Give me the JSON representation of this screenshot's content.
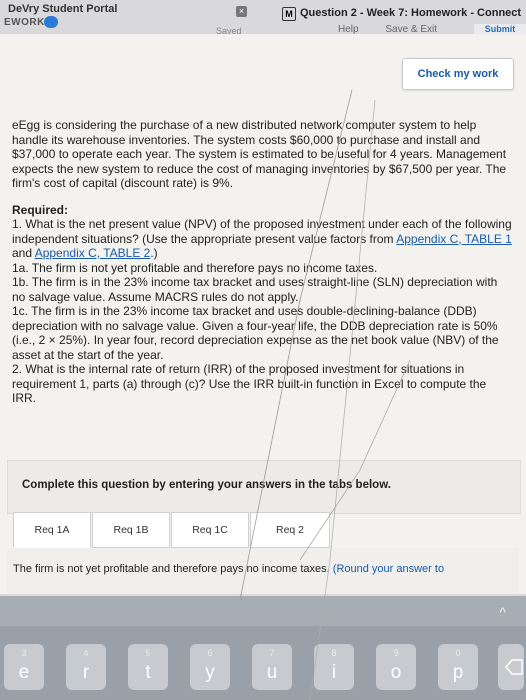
{
  "tabs": {
    "left_title": "DeVry Student Portal",
    "left_sub": "EWORK",
    "right_title": "Question 2 - Week 7: Homework - Connect",
    "toolbar": [
      "Help",
      "Save & Exit"
    ],
    "submit": "Submit",
    "saved": "Saved"
  },
  "check_label": "Check my work",
  "question": {
    "intro": "eEgg is considering the purchase of a new distributed network computer system to help handle its warehouse inventories. The system costs $60,000 to purchase and install and $37,000 to operate each year. The system is estimated to be useful for 4 years. Management expects the new system to reduce the cost of managing inventories by $67,500 per year. The firm's cost of capital (discount rate) is 9%.",
    "required_heading": "Required:",
    "q1_pre": "1. What is the net present value (NPV) of the proposed investment under each of the following independent situations? (Use the appropriate present value factors from ",
    "link1": "Appendix C, TABLE 1",
    "q1_mid": " and ",
    "link2": "Appendix C, TABLE 2",
    "q1_post": ".)",
    "q1a": "1a. The firm is not yet profitable and therefore pays no income taxes.",
    "q1b": "1b. The firm is in the 23% income tax bracket and uses straight-line (SLN) depreciation with no salvage value. Assume MACRS rules do not apply.",
    "q1c": "1c. The firm is in the 23%  income tax bracket and uses double-declining-balance (DDB) depreciation with no salvage value. Given a four-year life, the DDB depreciation rate is 50% (i.e., 2 × 25%). In year four, record depreciation expense as the net book value (NBV) of the asset at the start of the year.",
    "q2": "2. What is the internal rate of return (IRR) of the proposed investment for situations in requirement 1, parts (a) through (c)? Use the IRR built-in function in Excel to compute the IRR."
  },
  "complete_text": "Complete this question by entering your answers in the tabs below.",
  "req_tabs": [
    "Req 1A",
    "Req 1B",
    "Req 1C",
    "Req 2"
  ],
  "answer_text": "The firm is not yet profitable and therefore pays no income taxes.",
  "answer_note": "(Round your answer to",
  "keyboard": {
    "keys": [
      {
        "n": "3",
        "l": "e"
      },
      {
        "n": "4",
        "l": "r"
      },
      {
        "n": "5",
        "l": "t"
      },
      {
        "n": "6",
        "l": "y"
      },
      {
        "n": "7",
        "l": "u"
      },
      {
        "n": "8",
        "l": "i"
      },
      {
        "n": "9",
        "l": "o"
      },
      {
        "n": "0",
        "l": "p"
      }
    ],
    "chevron": "^"
  }
}
